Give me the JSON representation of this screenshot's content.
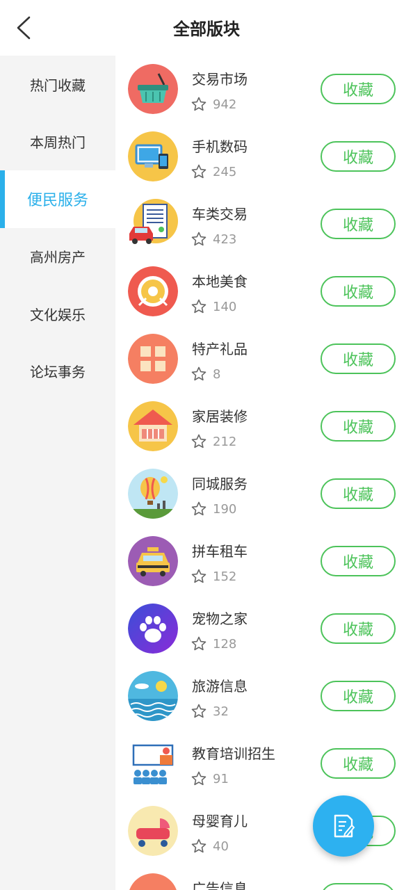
{
  "header": {
    "title": "全部版块"
  },
  "sidebar": {
    "items": [
      {
        "label": "热门收藏",
        "active": false
      },
      {
        "label": "本周热门",
        "active": false
      },
      {
        "label": "便民服务",
        "active": true
      },
      {
        "label": "高州房产",
        "active": false
      },
      {
        "label": "文化娱乐",
        "active": false
      },
      {
        "label": "论坛事务",
        "active": false
      }
    ],
    "accent_color": "#2bb0ea"
  },
  "list": {
    "button_label": "收藏",
    "button_color": "#4cc35a",
    "items": [
      {
        "name": "交易市场",
        "count": "942",
        "icon": "shopping-basket-icon"
      },
      {
        "name": "手机数码",
        "count": "245",
        "icon": "computer-phone-icon"
      },
      {
        "name": "车类交易",
        "count": "423",
        "icon": "car-icon"
      },
      {
        "name": "本地美食",
        "count": "140",
        "icon": "food-plate-icon"
      },
      {
        "name": "特产礼品",
        "count": "8",
        "icon": "gift-box-icon"
      },
      {
        "name": "家居装修",
        "count": "212",
        "icon": "house-icon"
      },
      {
        "name": "同城服务",
        "count": "190",
        "icon": "hot-air-balloon-icon"
      },
      {
        "name": "拼车租车",
        "count": "152",
        "icon": "taxi-icon"
      },
      {
        "name": "宠物之家",
        "count": "128",
        "icon": "paw-icon"
      },
      {
        "name": "旅游信息",
        "count": "32",
        "icon": "sun-sea-icon"
      },
      {
        "name": "教育培训招生",
        "count": "91",
        "icon": "classroom-icon"
      },
      {
        "name": "母婴育儿",
        "count": "40",
        "icon": "stroller-icon"
      },
      {
        "name": "广告信息",
        "count": "",
        "icon": "ad-icon"
      }
    ]
  },
  "fab": {
    "icon": "edit-note-icon",
    "color": "#2db1f0"
  }
}
